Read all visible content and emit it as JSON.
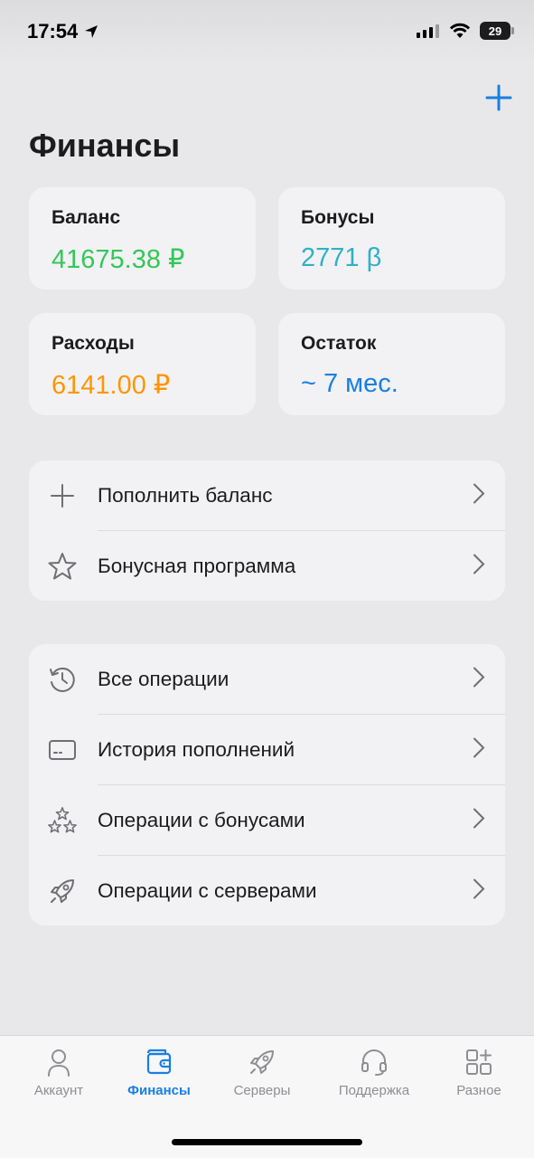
{
  "status_bar": {
    "time": "17:54",
    "battery": "29"
  },
  "page": {
    "title": "Финансы"
  },
  "stats": [
    {
      "label": "Баланс",
      "value": "41675.38 ₽",
      "color": "#34c759"
    },
    {
      "label": "Бонусы",
      "value": "2771 β",
      "color": "#30b0c7"
    },
    {
      "label": "Расходы",
      "value": "6141.00 ₽",
      "color": "#ff9500"
    },
    {
      "label": "Остаток",
      "value": "~ 7 мес.",
      "color": "#1a7fe0"
    }
  ],
  "actions": [
    {
      "label": "Пополнить баланс",
      "icon": "plus-icon"
    },
    {
      "label": "Бонусная программа",
      "icon": "star-icon"
    }
  ],
  "operations": [
    {
      "label": "Все операции",
      "icon": "history-icon"
    },
    {
      "label": "История пополнений",
      "icon": "card-icon"
    },
    {
      "label": "Операции с бонусами",
      "icon": "stars-icon"
    },
    {
      "label": "Операции с серверами",
      "icon": "rocket-icon"
    }
  ],
  "tabs": [
    {
      "label": "Аккаунт",
      "icon": "person-icon"
    },
    {
      "label": "Финансы",
      "icon": "wallet-icon",
      "active": true
    },
    {
      "label": "Серверы",
      "icon": "rocket-icon"
    },
    {
      "label": "Поддержка",
      "icon": "headset-icon"
    },
    {
      "label": "Разное",
      "icon": "grid-plus-icon"
    }
  ],
  "colors": {
    "accent": "#1a7fe0",
    "inactive": "#8e8e93"
  }
}
